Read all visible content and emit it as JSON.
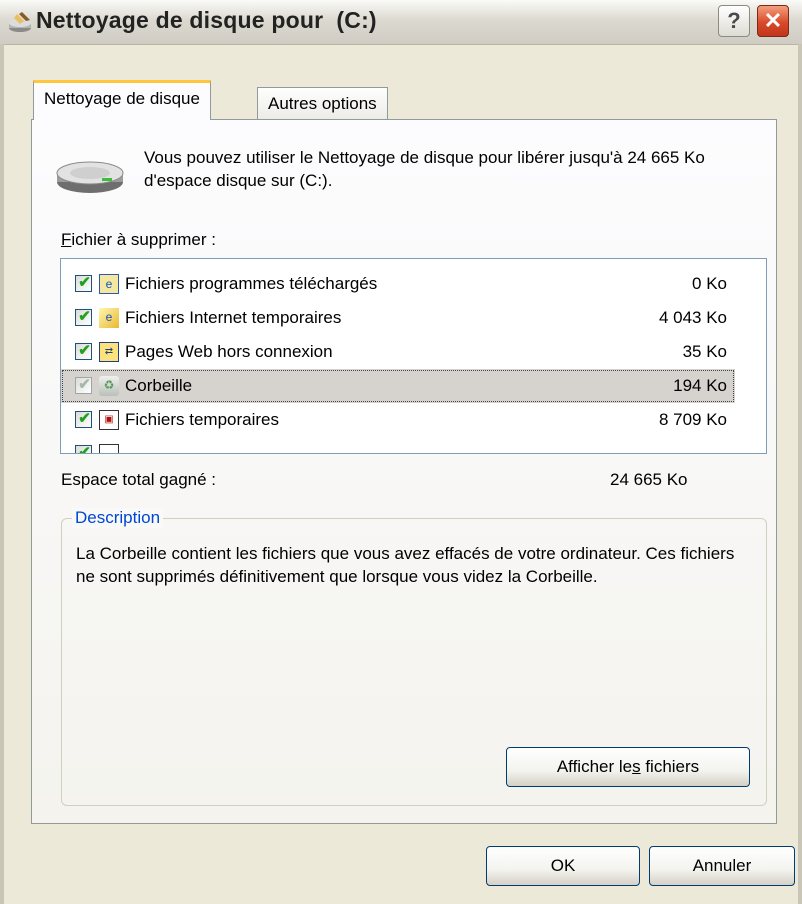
{
  "window": {
    "title": "Nettoyage de disque pour  (C:)",
    "help_label": "?",
    "close_label": "✕"
  },
  "tabs": [
    {
      "label": "Nettoyage de disque",
      "active": true
    },
    {
      "label": "Autres options",
      "active": false
    }
  ],
  "info": {
    "text": "Vous pouvez utiliser le Nettoyage de disque pour libérer jusqu'à 24 665 Ko d'espace disque sur  (C:)."
  },
  "files": {
    "label_mnemonic": "F",
    "label_rest": "ichier à supprimer :",
    "items": [
      {
        "label": "Fichiers programmes téléchargés",
        "size": "0 Ko",
        "checked": true,
        "icon": "downloaded-programs-icon",
        "selected": false
      },
      {
        "label": "Fichiers Internet temporaires",
        "size": "4 043 Ko",
        "checked": true,
        "icon": "internet-temp-files-icon",
        "selected": false
      },
      {
        "label": "Pages Web hors connexion",
        "size": "35 Ko",
        "checked": true,
        "icon": "offline-web-pages-icon",
        "selected": false
      },
      {
        "label": "Corbeille",
        "size": "194 Ko",
        "checked": true,
        "icon": "recycle-bin-icon",
        "selected": true
      },
      {
        "label": "Fichiers temporaires",
        "size": "8 709 Ko",
        "checked": true,
        "icon": "temp-files-icon",
        "selected": false
      }
    ]
  },
  "total": {
    "label": "Espace total gagné :",
    "value": "24 665 Ko"
  },
  "description": {
    "title": "Description",
    "text": "La Corbeille contient les fichiers que vous avez effacés de votre ordinateur. Ces fichiers ne sont supprimés définitivement que lorsque vous videz la Corbeille."
  },
  "buttons": {
    "show_files_pre": "Afficher le",
    "show_files_mnemonic": "s",
    "show_files_post": " fichiers",
    "ok": "OK",
    "cancel": "Annuler"
  },
  "colors": {
    "window_bg": "#ece9d8",
    "tab_accent": "#ffc83c",
    "group_title": "#0046d5",
    "checkmark": "#21a121",
    "close_button": "#d94a2a"
  }
}
